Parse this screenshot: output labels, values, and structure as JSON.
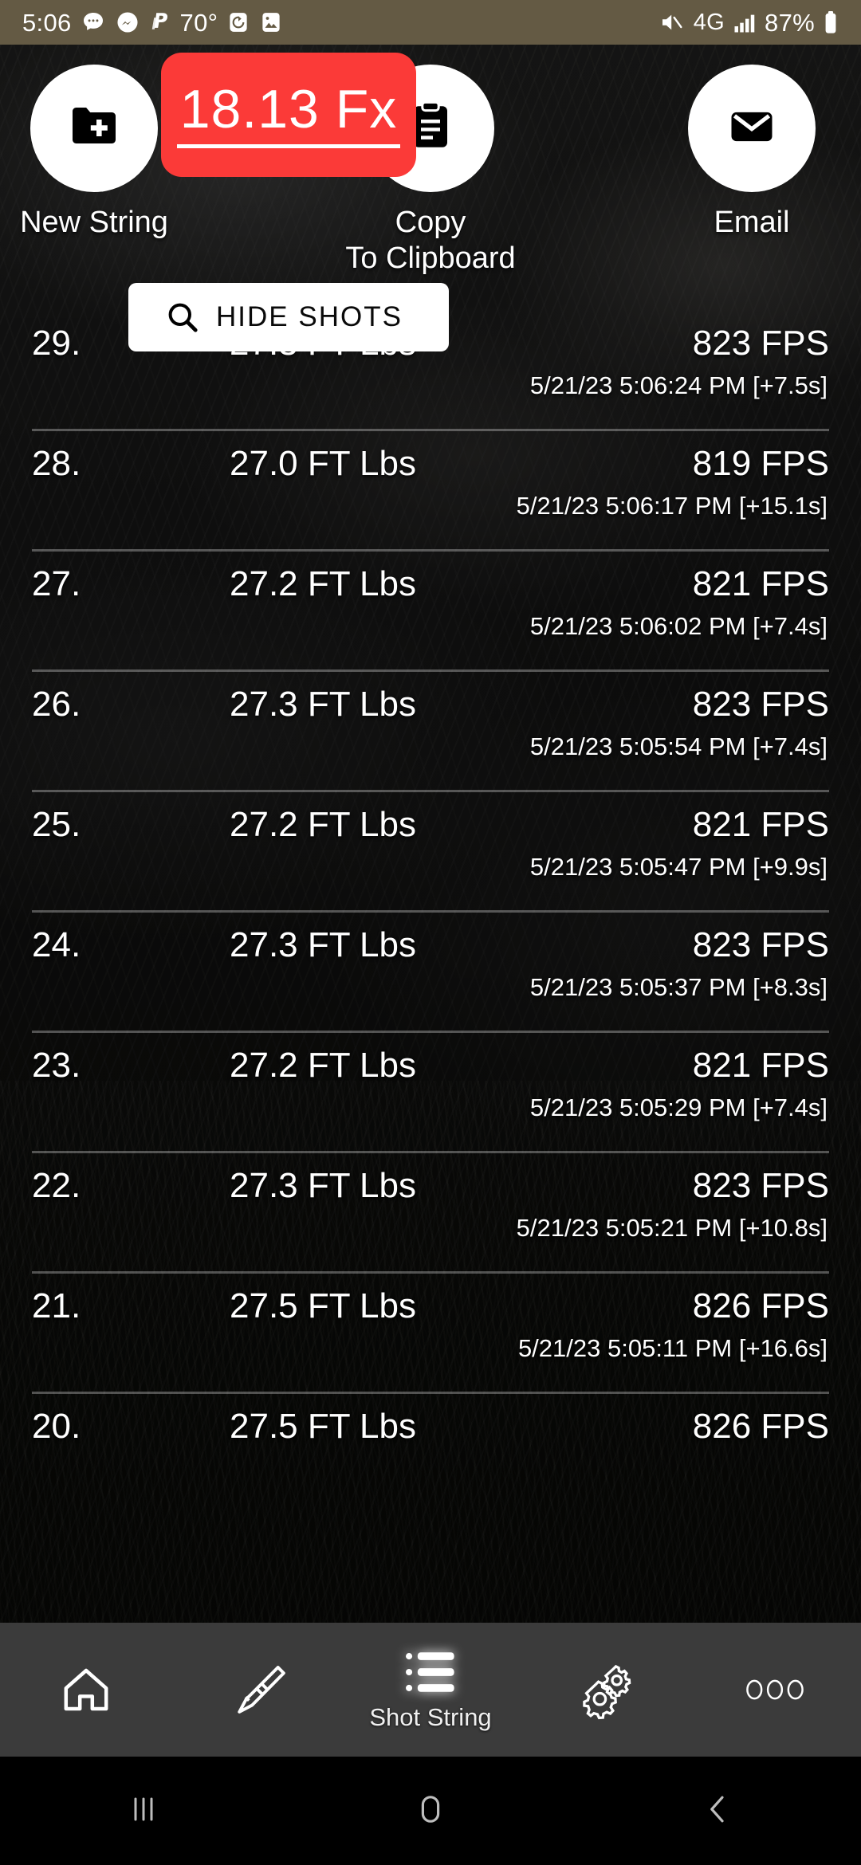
{
  "status_bar": {
    "time": "5:06",
    "temperature": "70°",
    "battery_percent": "87%",
    "network": "4G",
    "left_icons": [
      "messages-icon",
      "messenger-icon",
      "paypal-icon",
      "alarm-icon",
      "photo-icon"
    ],
    "right_icons": [
      "mute-icon",
      "network-4g-icon",
      "signal-bars-icon",
      "battery-icon"
    ],
    "background_color": "#645a44"
  },
  "top_actions": {
    "new_string": {
      "label": "New String",
      "icon": "folder-plus-icon"
    },
    "copy_clipboard": {
      "label": "Copy\nTo Clipboard",
      "label_line1": "Copy",
      "label_line2": "To Clipboard",
      "icon": "clipboard-icon"
    },
    "email": {
      "label": "Email",
      "icon": "envelope-icon"
    }
  },
  "fx_badge": {
    "value": "18.13 Fx",
    "color": "#fb3a38",
    "text_color": "#ffffff"
  },
  "hide_shots": {
    "label": "HIDE SHOTS",
    "icon": "search-icon"
  },
  "shots": {
    "columns": [
      "index",
      "energy",
      "speed",
      "timestamp"
    ],
    "rows": [
      {
        "index": "29.",
        "energy": "27.3 FT Lbs",
        "speed": "823 FPS",
        "timestamp": "5/21/23 5:06:24 PM [+7.5s]"
      },
      {
        "index": "28.",
        "energy": "27.0 FT Lbs",
        "speed": "819 FPS",
        "timestamp": "5/21/23 5:06:17 PM [+15.1s]"
      },
      {
        "index": "27.",
        "energy": "27.2 FT Lbs",
        "speed": "821 FPS",
        "timestamp": "5/21/23 5:06:02 PM [+7.4s]"
      },
      {
        "index": "26.",
        "energy": "27.3 FT Lbs",
        "speed": "823 FPS",
        "timestamp": "5/21/23 5:05:54 PM [+7.4s]"
      },
      {
        "index": "25.",
        "energy": "27.2 FT Lbs",
        "speed": "821 FPS",
        "timestamp": "5/21/23 5:05:47 PM [+9.9s]"
      },
      {
        "index": "24.",
        "energy": "27.3 FT Lbs",
        "speed": "823 FPS",
        "timestamp": "5/21/23 5:05:37 PM [+8.3s]"
      },
      {
        "index": "23.",
        "energy": "27.2 FT Lbs",
        "speed": "821 FPS",
        "timestamp": "5/21/23 5:05:29 PM [+7.4s]"
      },
      {
        "index": "22.",
        "energy": "27.3 FT Lbs",
        "speed": "823 FPS",
        "timestamp": "5/21/23 5:05:21 PM [+10.8s]"
      },
      {
        "index": "21.",
        "energy": "27.5 FT Lbs",
        "speed": "826 FPS",
        "timestamp": "5/21/23 5:05:11 PM [+16.6s]"
      },
      {
        "index": "20.",
        "energy": "27.5 FT Lbs",
        "speed": "826 FPS",
        "timestamp": ""
      }
    ]
  },
  "bottom_nav": {
    "items": [
      {
        "icon": "home-icon",
        "label": "",
        "active": false
      },
      {
        "icon": "rifle-icon",
        "label": "",
        "active": false
      },
      {
        "icon": "list-icon",
        "label": "Shot String",
        "active": true
      },
      {
        "icon": "gears-icon",
        "label": "",
        "active": false
      },
      {
        "icon": "more-dots-icon",
        "label": "",
        "active": false
      }
    ],
    "background_color": "#3b3b3b"
  },
  "system_nav": {
    "items": [
      "recents-icon",
      "home-circle-icon",
      "back-icon"
    ]
  }
}
